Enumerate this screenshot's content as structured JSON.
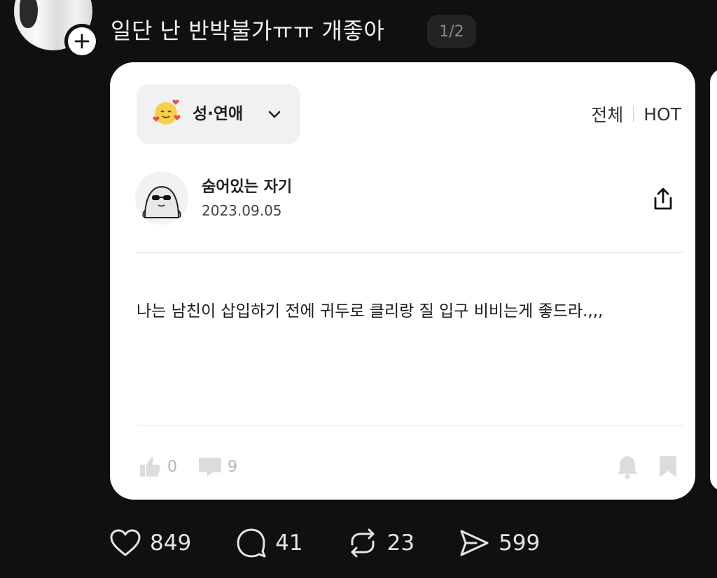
{
  "post": {
    "title": "일단 난 반박불가ㅠㅠ 개좋아",
    "page_indicator": "1/2"
  },
  "card": {
    "category": {
      "label": "성·연애",
      "icon": "smiling-face-with-hearts-icon"
    },
    "filters": [
      "전체",
      "HOT"
    ],
    "author": {
      "name": "숨어있는 자기",
      "date": "2023.09.05"
    },
    "body": "나는 남친이 삽입하기 전에 귀두로 클리랑 질 입구 비비는게 좋드라.,,,",
    "likes": "0",
    "comments": "9"
  },
  "actions": {
    "likes": "849",
    "replies": "41",
    "reposts": "23",
    "shares": "599"
  },
  "colors": {
    "background": "#101010",
    "card": "#ffffff",
    "text_light": "#f2f2f2"
  }
}
